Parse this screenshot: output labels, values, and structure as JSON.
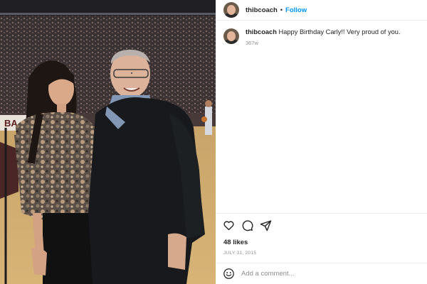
{
  "header": {
    "username": "thibcoach",
    "separator": "•",
    "follow_label": "Follow",
    "avatar_icon": "profile-avatar"
  },
  "caption": {
    "username": "thibcoach",
    "text": "Happy Birthday Carly!! Very proud of you.",
    "time": "367w"
  },
  "actions": {
    "icons": [
      "heart-icon",
      "comment-icon",
      "share-icon"
    ]
  },
  "likes": "48 likes",
  "date": "JULY 31, 2015",
  "comment": {
    "placeholder": "Add a comment...",
    "emoji_icon": "emoji-icon"
  },
  "colors": {
    "accent": "#0095f6",
    "text": "#262626",
    "muted": "#8e8e8e",
    "border": "#efefef"
  }
}
